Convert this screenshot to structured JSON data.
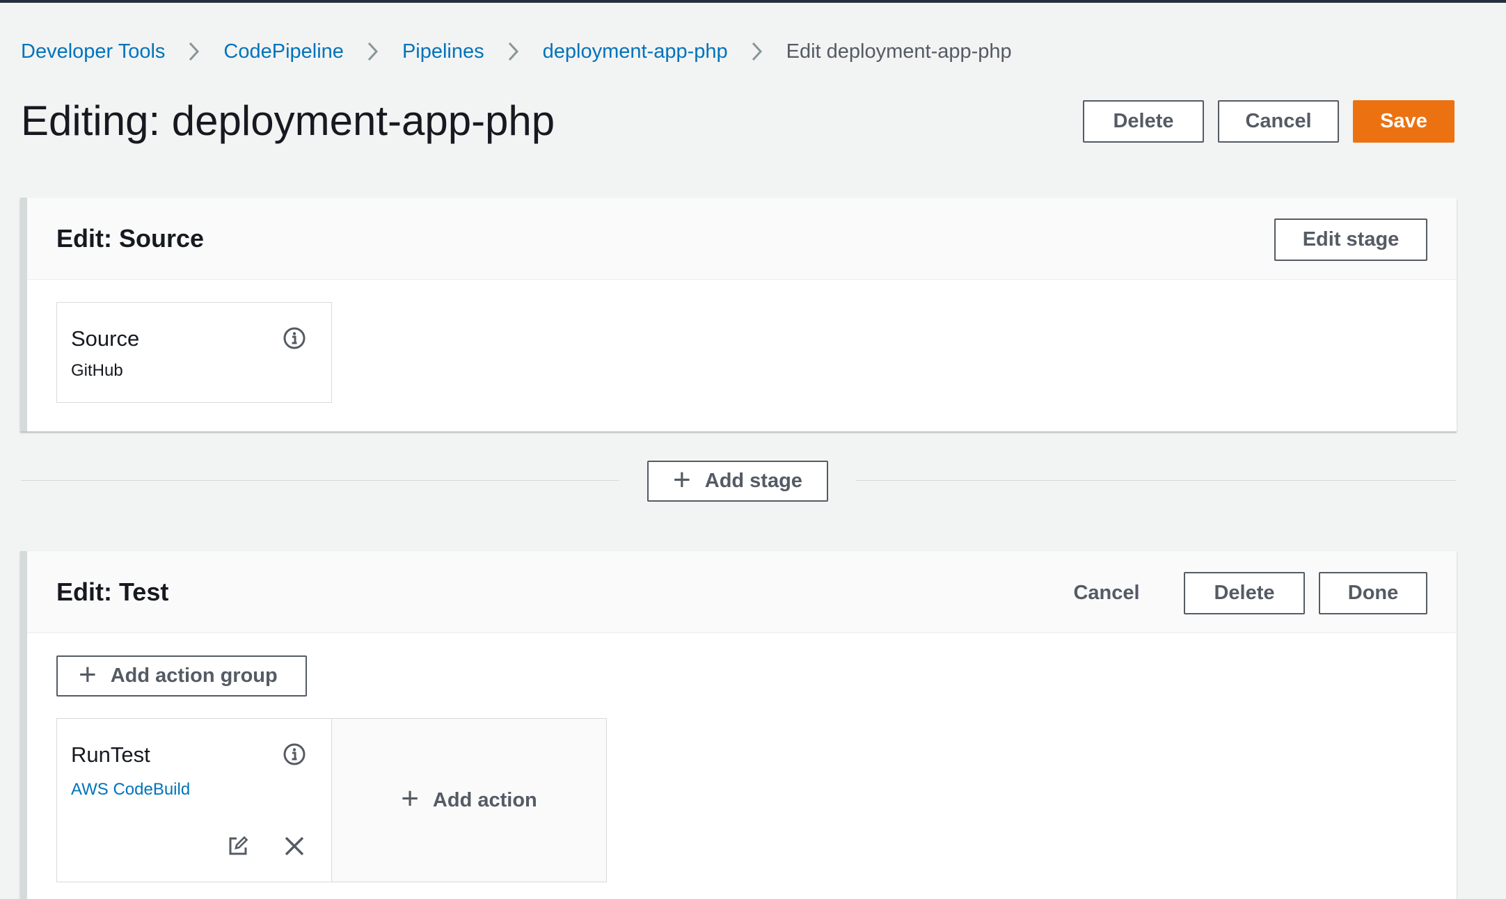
{
  "breadcrumb": {
    "items": [
      {
        "label": "Developer Tools"
      },
      {
        "label": "CodePipeline"
      },
      {
        "label": "Pipelines"
      },
      {
        "label": "deployment-app-php"
      }
    ],
    "current": "Edit deployment-app-php"
  },
  "header": {
    "title": "Editing: deployment-app-php",
    "delete_label": "Delete",
    "cancel_label": "Cancel",
    "save_label": "Save"
  },
  "source_stage": {
    "title": "Edit: Source",
    "edit_stage_label": "Edit stage",
    "action": {
      "name": "Source",
      "provider": "GitHub",
      "info_icon": "info-icon"
    }
  },
  "add_stage_label": "Add stage",
  "test_stage": {
    "title": "Edit: Test",
    "cancel_label": "Cancel",
    "delete_label": "Delete",
    "done_label": "Done",
    "add_action_group_label": "Add action group",
    "action": {
      "name": "RunTest",
      "provider": "AWS CodeBuild",
      "info_icon": "info-icon",
      "edit_icon": "edit-icon",
      "remove_icon": "close-icon"
    },
    "add_action_label": "Add action"
  },
  "colors": {
    "link": "#0073bb",
    "primary": "#ec7211",
    "button_text": "#545b64",
    "background": "#f2f3f3"
  }
}
